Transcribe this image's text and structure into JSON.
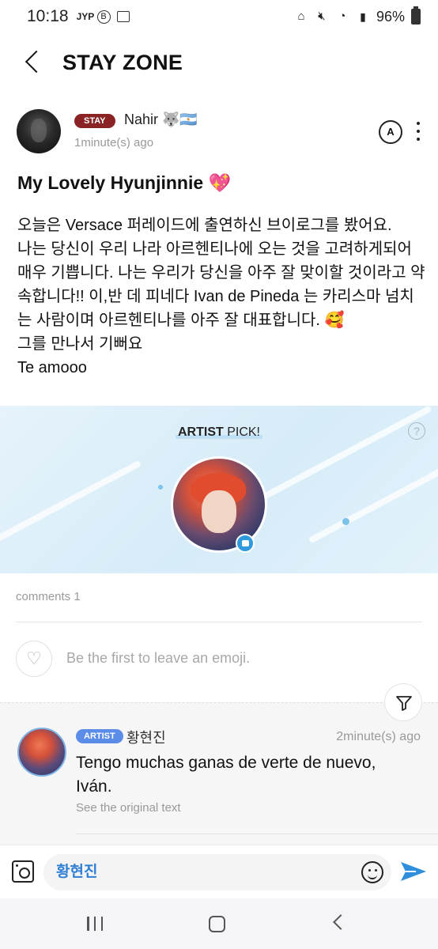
{
  "status_bar": {
    "time": "10:18",
    "left_icons": [
      "jyp-icon",
      "b-icon",
      "image-icon"
    ],
    "battery": "96%"
  },
  "header": {
    "title": "STAY ZONE"
  },
  "post": {
    "author_badge": "STAY",
    "author_name": "Nahir 🐺🇦🇷",
    "time": "1minute(s) ago",
    "translate_icon": "A",
    "title": "My Lovely Hyunjinnie 💖",
    "body": "오늘은 Versace 퍼레이드에 출연하신 브이로그를 봤어요.\n나는 당신이 우리 나라 아르헨티나에 오는 것을 고려하게되어 매우 기쁩니다. 나는 우리가 당신을 아주 잘 맞이할 것이라고 약속합니다!! 이,반 데 피네다 Ivan de Pineda 는 카리스마 넘치는 사람이며 아르헨티나를 아주 잘 대표합니다. 🥰\n그를 만나서 기뻐요\nTe amooo"
  },
  "artist_pick": {
    "label_bold": "ARTIST",
    "label_rest": " PICK!",
    "help": "?"
  },
  "comments": {
    "count_label": "comments 1",
    "emoji_hint": "Be the first to leave an emoji.",
    "items": [
      {
        "badge": "ARTIST",
        "name": "황현진",
        "time": "2minute(s) ago",
        "text": "Tengo muchas ganas de verte de nuevo, Iván.",
        "see_original": "See the original text"
      }
    ]
  },
  "input": {
    "value": "황현진"
  },
  "colors": {
    "stay_badge": "#8a2323",
    "artist_badge": "#5b8de8",
    "send": "#2f8fdc",
    "input_text": "#2f7fd3"
  }
}
